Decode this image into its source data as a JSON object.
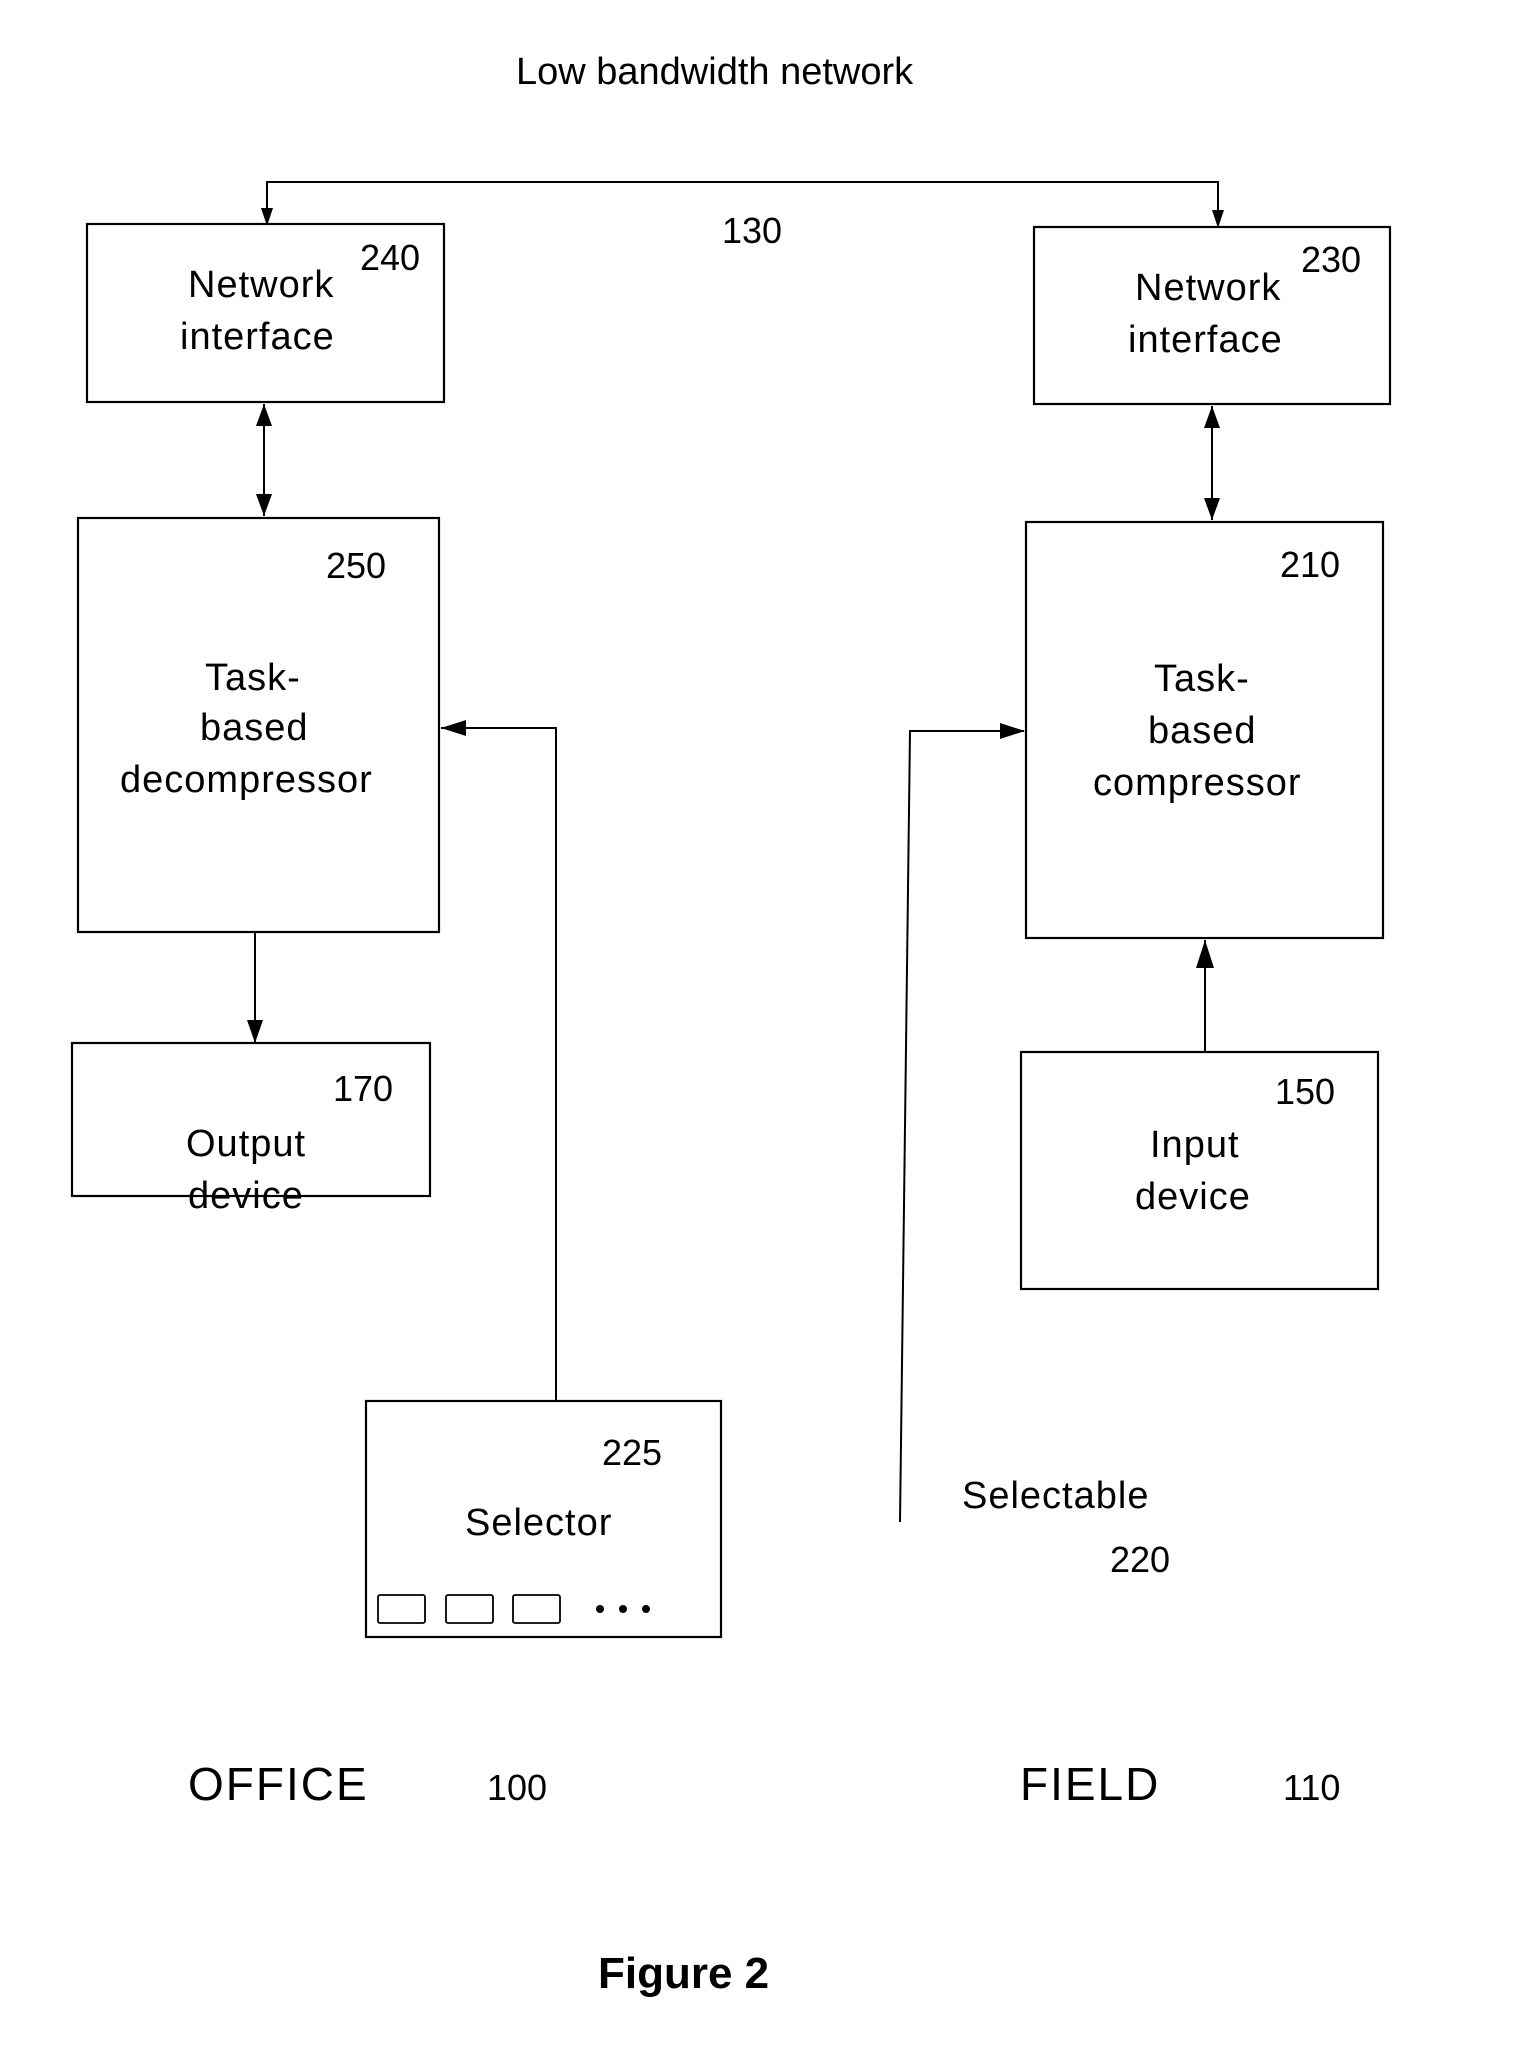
{
  "diagram": {
    "network": {
      "title": "Low bandwidth network",
      "ref": "130"
    },
    "office": {
      "label": "OFFICE",
      "ref": "100",
      "network_interface": {
        "lines": [
          "Network",
          "interface"
        ],
        "ref": "240"
      },
      "decompressor": {
        "lines": [
          "Task-",
          "based",
          "decompressor"
        ],
        "ref": "250"
      },
      "output_device": {
        "lines": [
          "Output",
          "device"
        ],
        "ref": "170"
      },
      "selector": {
        "label": "Selector",
        "ref": "225",
        "buttons": 3,
        "more": "• • •"
      }
    },
    "field": {
      "label": "FIELD",
      "ref": "110",
      "network_interface": {
        "lines": [
          "Network",
          "interface"
        ],
        "ref": "230"
      },
      "compressor": {
        "lines": [
          "Task-",
          "based",
          "compressor"
        ],
        "ref": "210"
      },
      "input_device": {
        "lines": [
          "Input",
          "device"
        ],
        "ref": "150"
      },
      "selectable": {
        "label": "Selectable",
        "ref": "220"
      }
    },
    "caption": "Figure 2"
  }
}
